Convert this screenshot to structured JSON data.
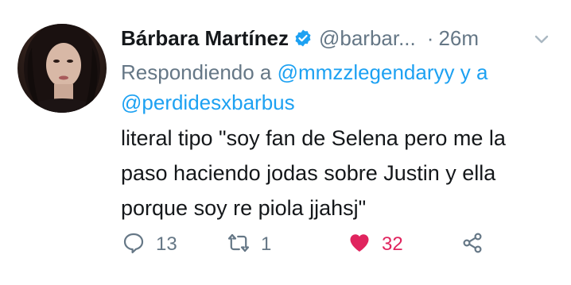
{
  "tweet": {
    "author_name": "Bárbara Martínez",
    "author_handle": "@barbar...",
    "separator": "·",
    "time": "26m",
    "reply_prefix": "Respondiendo a ",
    "reply_mention_1": "@mmzzlegendaryy",
    "reply_joiner": " y a ",
    "reply_mention_2": "@perdidesxbarbus",
    "text": "literal tipo \"soy fan de Selena pero me la paso haciendo jodas sobre Justin y ella porque soy re piola jjahsj\""
  },
  "actions": {
    "reply_count": "13",
    "retweet_count": "1",
    "like_count": "32"
  },
  "colors": {
    "text": "#14171a",
    "muted": "#657786",
    "link": "#1da1f2",
    "like": "#e0245e",
    "verified": "#1da1f2"
  },
  "icons": {
    "verified": "verified-badge-icon",
    "menu": "chevron-down-icon",
    "reply": "reply-icon",
    "retweet": "retweet-icon",
    "like": "heart-icon",
    "share": "share-icon"
  }
}
